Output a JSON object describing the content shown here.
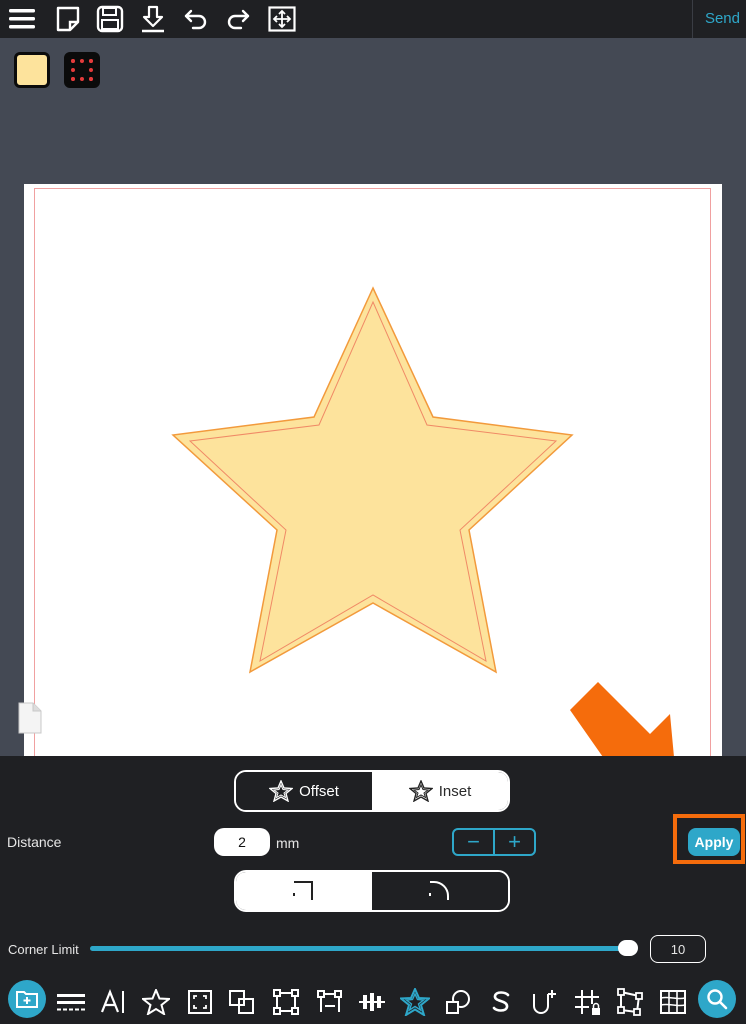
{
  "toolbar": {
    "icons": [
      "menu-icon",
      "new-page-icon",
      "save-icon",
      "download-icon",
      "undo-icon",
      "redo-icon",
      "fit-icon"
    ],
    "send_label": "Send"
  },
  "swatches": {
    "fill_color": "#fde39c",
    "outline_color": "#d62b2b"
  },
  "canvas": {
    "shape": "star",
    "fill": "#fde39c",
    "stroke": "#f29a3c"
  },
  "offset_panel": {
    "mode_tabs": [
      {
        "label": "Offset",
        "selected": false
      },
      {
        "label": "Inset",
        "selected": true
      }
    ],
    "distance_label": "Distance",
    "distance_value": "2",
    "distance_unit": "mm",
    "stepper_minus": "−",
    "stepper_plus": "+",
    "apply_label": "Apply",
    "corner_styles": [
      {
        "name": "sharp",
        "selected": true
      },
      {
        "name": "rounded",
        "selected": false
      }
    ],
    "corner_limit_label": "Corner Limit",
    "corner_limit_value": "10",
    "corner_limit_fraction": 0.98
  },
  "bottom_toolbar": {
    "icons": [
      "add-folder-icon",
      "layers-icon",
      "text-icon",
      "star-shape-icon",
      "frame-icon",
      "duplicate-icon",
      "crop-icon",
      "node-icon",
      "align-icon",
      "offset-star-icon",
      "shapes-icon",
      "s-icon",
      "weld-icon",
      "grid-lock-icon",
      "warp-icon",
      "table-icon",
      "search-icon"
    ]
  },
  "accent_color": "#2ea7c9",
  "highlight_color": "#f56c0c"
}
